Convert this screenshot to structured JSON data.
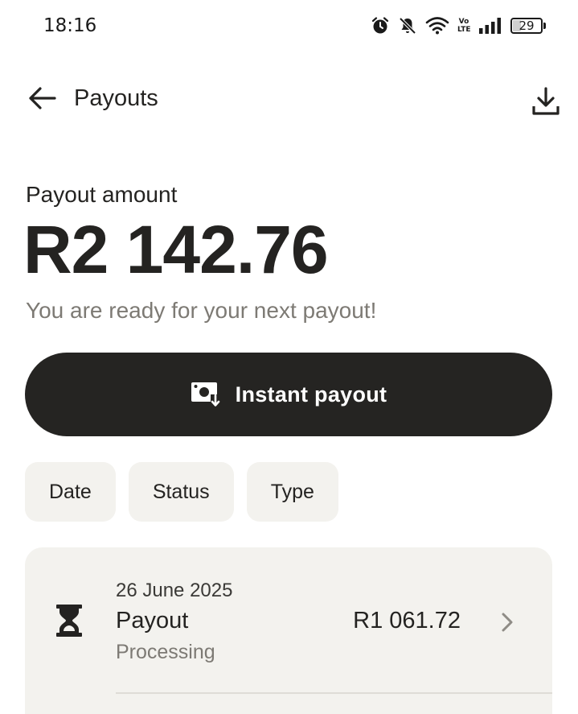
{
  "status_bar": {
    "time": "18:16",
    "battery": "29",
    "battery_level": 0.29,
    "network_label": "Vo LTE",
    "icons": [
      "alarm-icon",
      "bell-off-icon",
      "wifi-icon",
      "volte-icon",
      "signal-icon",
      "battery-icon"
    ]
  },
  "header": {
    "title": "Payouts",
    "back_icon": "arrow-left-icon",
    "download_icon": "download-icon"
  },
  "summary": {
    "amount_label": "Payout amount",
    "amount": "R2 142.76",
    "note": "You are ready for your next payout!"
  },
  "instant_payout": {
    "label": "Instant payout",
    "icon": "cash-download-icon"
  },
  "filters": [
    {
      "label": "Date"
    },
    {
      "label": "Status"
    },
    {
      "label": "Type"
    }
  ],
  "payouts": [
    {
      "date": "26 June 2025",
      "title": "Payout",
      "status": "Processing",
      "amount": "R1 061.72",
      "icon": "hourglass-icon"
    }
  ],
  "colors": {
    "primary_dark": "#252422",
    "surface": "#f3f2ee",
    "muted_text": "#7d7a74",
    "background": "#ffffff"
  }
}
